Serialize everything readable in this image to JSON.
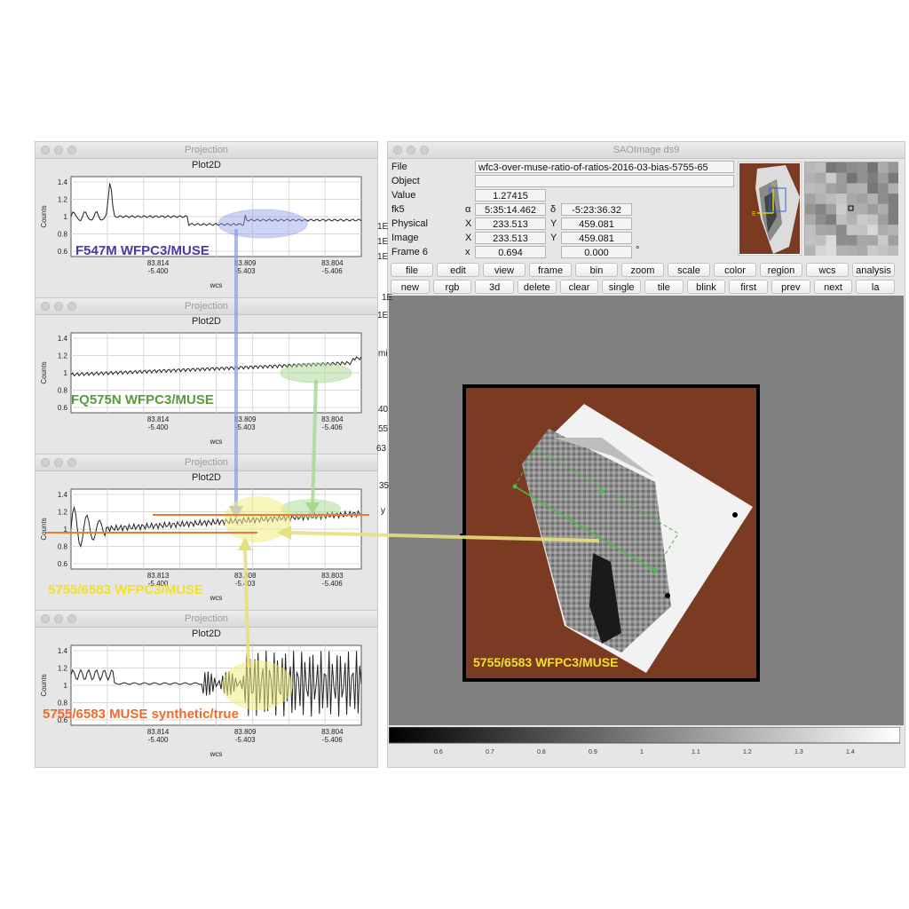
{
  "projection_windows": [
    {
      "window_title": "Projection",
      "plot_title": "Plot2D",
      "y_label": "Counts",
      "x_label": "wcs",
      "y_ticks": [
        "1.4",
        "1.2",
        "1",
        "0.8",
        "0.6"
      ],
      "x_ticks": [
        {
          "top": "83.814",
          "bottom": "-5.400"
        },
        {
          "top": "83.809",
          "bottom": "-5.403"
        },
        {
          "top": "83.804",
          "bottom": "-5.406"
        }
      ],
      "annotation": "F547M WFPC3/MUSE",
      "annotation_color": "#4a3aa8"
    },
    {
      "window_title": "Projection",
      "plot_title": "Plot2D",
      "y_label": "Counts",
      "x_label": "wcs",
      "y_ticks": [
        "1.4",
        "1.2",
        "1",
        "0.8",
        "0.6"
      ],
      "x_ticks": [
        {
          "top": "83.814",
          "bottom": "-5.400"
        },
        {
          "top": "83.809",
          "bottom": "-5.403"
        },
        {
          "top": "83.804",
          "bottom": "-5.406"
        }
      ],
      "annotation": "FQ575N WFPC3/MUSE",
      "annotation_color": "#5a9a3a"
    },
    {
      "window_title": "Projection",
      "plot_title": "Plot2D",
      "y_label": "Counts",
      "x_label": "wcs",
      "y_ticks": [
        "1.4",
        "1.2",
        "1",
        "0.8",
        "0.6"
      ],
      "x_ticks": [
        {
          "top": "83.813",
          "bottom": "-5.400"
        },
        {
          "top": "83.808",
          "bottom": "-5.403"
        },
        {
          "top": "83.803",
          "bottom": "-5.406"
        }
      ],
      "annotation": "5755/6583 WFPC3/MUSE",
      "annotation_color": "#f2e02a"
    },
    {
      "window_title": "Projection",
      "plot_title": "Plot2D",
      "y_label": "Counts",
      "x_label": "wcs",
      "y_ticks": [
        "1.4",
        "1.2",
        "1",
        "0.8",
        "0.6"
      ],
      "x_ticks": [
        {
          "top": "83.814",
          "bottom": "-5.400"
        },
        {
          "top": "83.809",
          "bottom": "-5.403"
        },
        {
          "top": "83.804",
          "bottom": "-5.406"
        }
      ],
      "annotation": "5755/6583 MUSE synthetic/true",
      "annotation_color": "#f06a2a"
    }
  ],
  "ds9": {
    "window_title": "SAOImage ds9",
    "info": {
      "file_label": "File",
      "file_value": "wfc3-over-muse-ratio-of-ratios-2016-03-bias-5755-65",
      "object_label": "Object",
      "object_value": "",
      "value_label": "Value",
      "value_value": "1.27415",
      "fk5_label": "fk5",
      "alpha": "α",
      "alpha_value": "5:35:14.462",
      "delta": "δ",
      "delta_value": "-5:23:36.32",
      "physical_label": "Physical",
      "phys_x_label": "X",
      "phys_x": "233.513",
      "phys_y_label": "Y",
      "phys_y": "459.081",
      "image_label": "Image",
      "img_x_label": "X",
      "img_x": "233.513",
      "img_y_label": "Y",
      "img_y": "459.081",
      "frame_label": "Frame 6",
      "frame_x_label": "x",
      "frame_zoom": "0.694",
      "frame_angle": "0.000",
      "degree": "°"
    },
    "button_row1": [
      "file",
      "edit",
      "view",
      "frame",
      "bin",
      "zoom",
      "scale",
      "color",
      "region",
      "wcs",
      "analysis"
    ],
    "button_row2": [
      "new",
      "rgb",
      "3d",
      "delete",
      "clear",
      "single",
      "tile",
      "blink",
      "first",
      "prev",
      "next",
      "la"
    ],
    "image_annotation": "5755/6583 WFPC3/MUSE",
    "colorbar_ticks": [
      "0.6",
      "0.7",
      "0.8",
      "0.9",
      "1",
      "1.1",
      "1.2",
      "1.3",
      "1.4"
    ],
    "side_fragments": [
      "1E",
      "1E",
      "1E",
      "1E",
      "1E",
      "mi",
      "40",
      "55",
      "63",
      "35",
      "y"
    ]
  },
  "colors": {
    "image_bg": "#7b3a22",
    "orange_line": "#f07a30",
    "blue_highlight": "#8fa0e8",
    "green_highlight": "#a8d890",
    "yellow_highlight": "#f0ec80"
  }
}
